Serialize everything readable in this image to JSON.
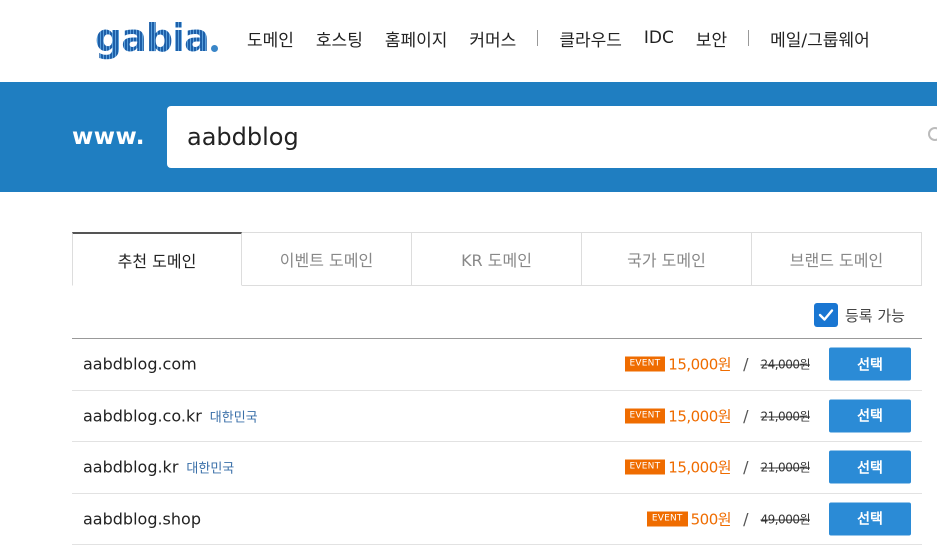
{
  "logo": {
    "text": "gabia"
  },
  "nav": {
    "items": [
      "도메인",
      "호스팅",
      "홈페이지",
      "커머스"
    ],
    "items2": [
      "클라우드",
      "IDC",
      "보안"
    ],
    "items3": [
      "메일/그룹웨어"
    ]
  },
  "search": {
    "prefix": "www.",
    "value": "aabdblog"
  },
  "tabs": [
    "추천 도메인",
    "이벤트 도메인",
    "KR 도메인",
    "국가 도메인",
    "브랜드 도메인"
  ],
  "filter": {
    "label": "등록 가능",
    "checked": true
  },
  "domains": [
    {
      "name": "aabdblog.com",
      "country": "",
      "badge": "EVENT",
      "price": "15,000원",
      "old_price": "24,000원",
      "button": "선택"
    },
    {
      "name": "aabdblog.co.kr",
      "country": "대한민국",
      "badge": "EVENT",
      "price": "15,000원",
      "old_price": "21,000원",
      "button": "선택"
    },
    {
      "name": "aabdblog.kr",
      "country": "대한민국",
      "badge": "EVENT",
      "price": "15,000원",
      "old_price": "21,000원",
      "button": "선택"
    },
    {
      "name": "aabdblog.shop",
      "country": "",
      "badge": "EVENT",
      "price": "500원",
      "old_price": "49,000원",
      "button": "선택"
    }
  ],
  "colors": {
    "brand_blue": "#1f7ec1",
    "event_orange": "#ef6c00",
    "button_blue": "#2b8bd6"
  }
}
